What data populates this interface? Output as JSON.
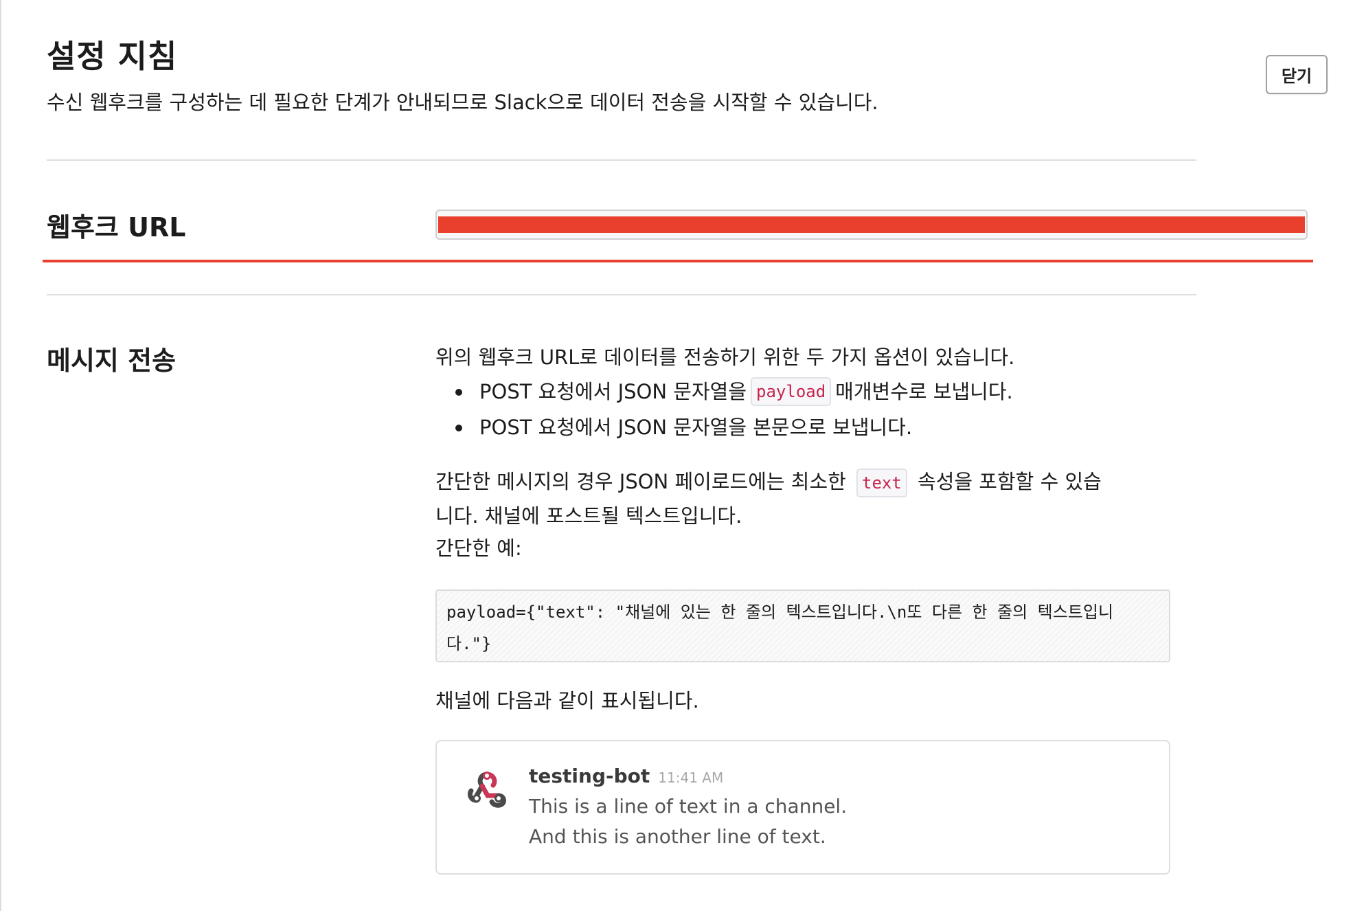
{
  "header": {
    "title": "설정 지침",
    "subtitle": "수신 웹후크를 구성하는 데 필요한 단계가 안내되므로 Slack으로 데이터 전송을 시작할 수 있습니다.",
    "close_label": "닫기"
  },
  "webhook": {
    "label": "웹후크 URL"
  },
  "send": {
    "label": "메시지 전송",
    "intro": "위의 웹후크 URL로 데이터를 전송하기 위한 두 가지 옵션이 있습니다.",
    "bullet1_pre": "POST 요청에서 JSON 문자열을",
    "bullet1_code": "payload",
    "bullet1_post": "매개변수로 보냅니다.",
    "bullet2": "POST 요청에서 JSON 문자열을 본문으로 보냅니다.",
    "simple_pre": "간단한 메시지의 경우 JSON 페이로드에는 최소한",
    "simple_code": "text",
    "simple_post": "속성을 포함할 수 있습",
    "simple_line2": "니다. 채널에 포스트될 텍스트입니다.",
    "example_label": "간단한 예:",
    "code_line1": "payload={\"text\": \"채널에 있는 한 줄의 텍스트입니다.\\n또 다른 한 줄의 텍스트입니",
    "code_line2": "다.\"}",
    "display_label": "채널에 다음과 같이 표시됩니다."
  },
  "preview": {
    "bot_name": "testing-bot",
    "time": "11:41 AM",
    "line1": "This is a line of text in a channel.",
    "line2": "And this is another line of text.",
    "avatar_icon": "webhook-icon"
  },
  "colors": {
    "redaction": "#e8402c",
    "code_text": "#c7254e",
    "webhook_pink": "#c93756",
    "webhook_gray": "#4a4a4a"
  }
}
